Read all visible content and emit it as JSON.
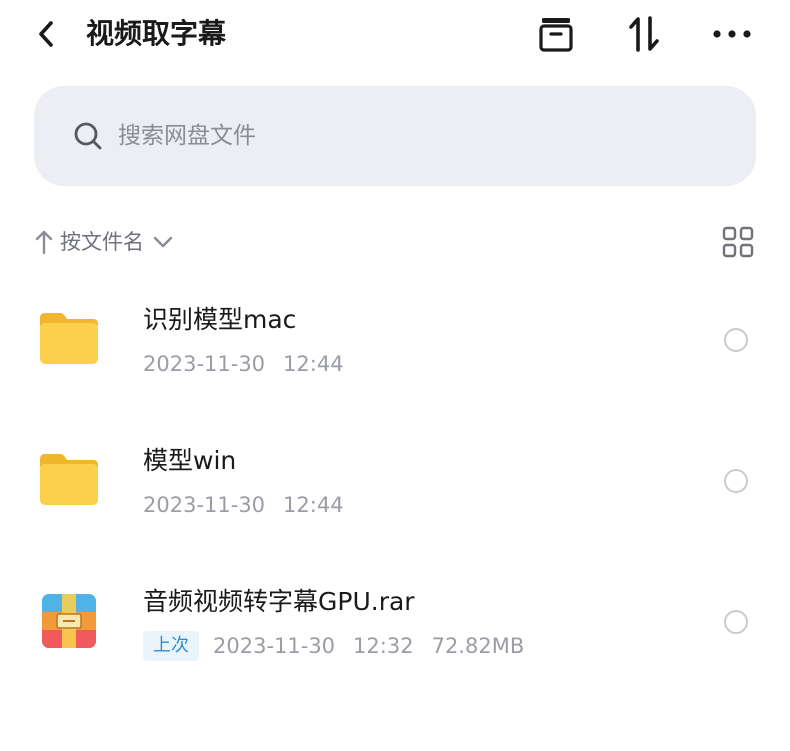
{
  "header": {
    "title": "视频取字幕",
    "back_icon": "chevron-left-icon",
    "icons": [
      "archive-icon",
      "sort-icon",
      "more-icon"
    ]
  },
  "search": {
    "placeholder": "搜索网盘文件",
    "icon": "search-icon"
  },
  "sort": {
    "label": "按文件名",
    "direction": "ascending",
    "view_toggle_icon": "grid-view-icon"
  },
  "files": [
    {
      "name": "识别模型mac",
      "type": "folder",
      "date": "2023-11-30",
      "time": "12:44",
      "color": "#f7c43b"
    },
    {
      "name": "模型win",
      "type": "folder",
      "date": "2023-11-30",
      "time": "12:44",
      "color": "#f7c43b"
    },
    {
      "name": "音频视频转字幕GPU.rar",
      "type": "archive",
      "badge": "上次",
      "date": "2023-11-30",
      "time": "12:32",
      "size": "72.82MB"
    }
  ],
  "colors": {
    "accent": "#2f8fd3",
    "search_bg": "#eceef4",
    "folder": "#f7c43b"
  }
}
